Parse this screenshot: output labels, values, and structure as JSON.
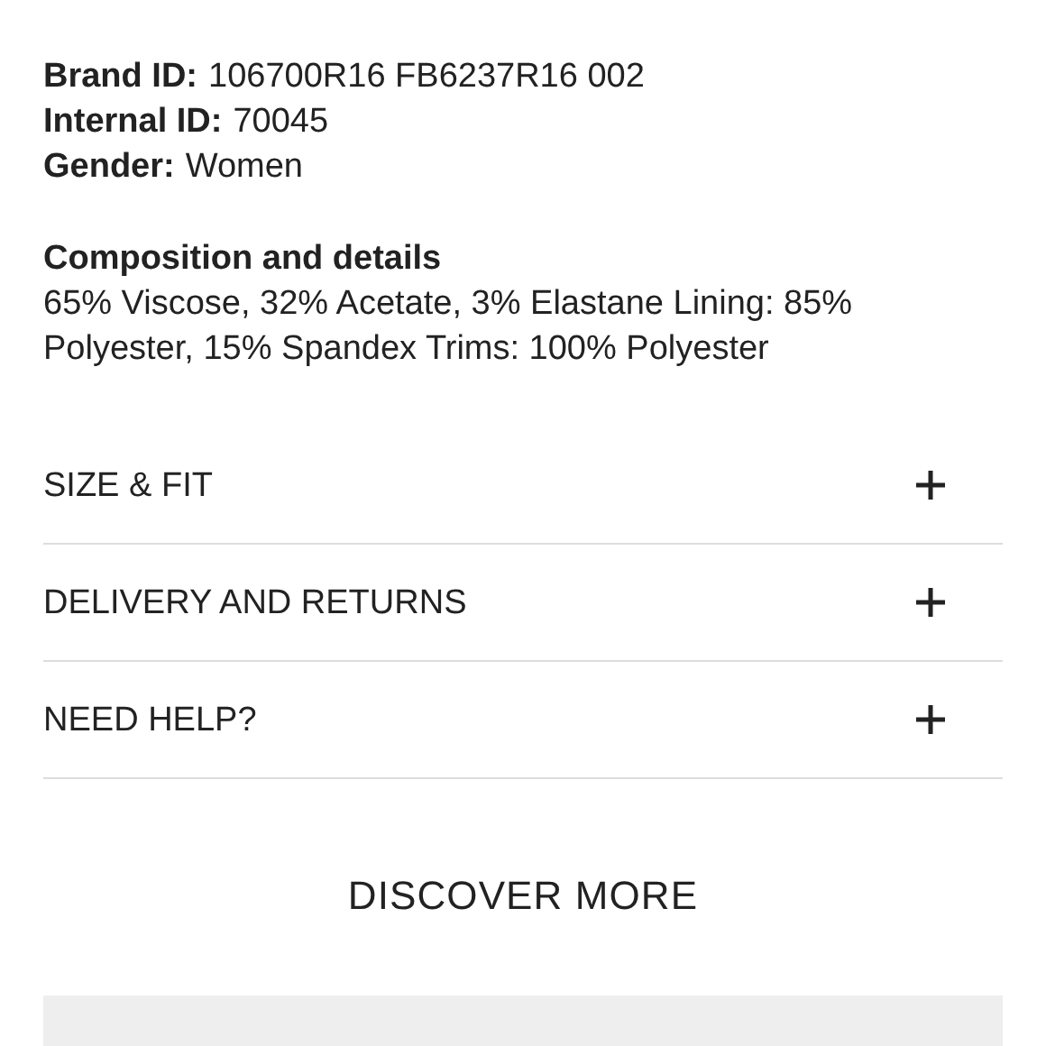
{
  "details": [
    {
      "label": "Brand ID:",
      "value": "106700R16 FB6237R16 002"
    },
    {
      "label": "Internal ID:",
      "value": "70045"
    },
    {
      "label": "Gender:",
      "value": "Women"
    }
  ],
  "composition": {
    "title": "Composition and details",
    "text": "65% Viscose, 32% Acetate, 3% Elastane Lining: 85% Polyester, 15% Spandex Trims: 100% Polyester"
  },
  "accordion": [
    {
      "label": "SIZE & FIT",
      "expanded": false
    },
    {
      "label": "DELIVERY AND RETURNS",
      "expanded": false
    },
    {
      "label": "NEED HELP?",
      "expanded": false
    }
  ],
  "discover_more": "DISCOVER MORE"
}
